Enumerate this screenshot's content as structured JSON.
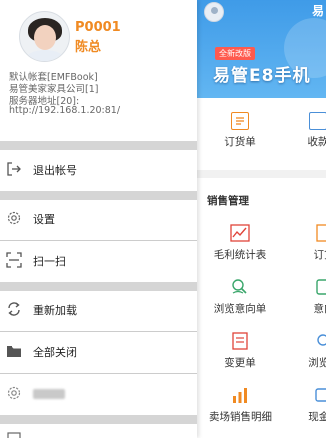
{
  "drawer": {
    "profile": {
      "user_code": "P0001",
      "user_name": "陈总",
      "lines": [
        "默认帐套[EMFBook]",
        "易管美家家具公司[1]",
        "服务器地址[20]:",
        "http://192.168.1.20:81/"
      ]
    },
    "menu": [
      {
        "label": "退出帐号",
        "icon": "logout-icon"
      },
      {
        "label": "设置",
        "icon": "gear-icon"
      },
      {
        "label": "扫一扫",
        "icon": "scan-icon"
      },
      {
        "label": "重新加载",
        "icon": "reload-icon"
      },
      {
        "label": "全部关闭",
        "icon": "folder-icon"
      },
      {
        "label": "",
        "icon": "gear-icon"
      }
    ]
  },
  "app": {
    "corner_text": "易",
    "banner": {
      "tag": "全新改版",
      "title": "易管E8手机"
    },
    "quick": [
      {
        "label": "订货单",
        "icon": "order-icon"
      },
      {
        "label": "收款",
        "icon": "receipt-icon"
      }
    ],
    "section_title": "销售管理",
    "grid": [
      {
        "label": "毛利统计表",
        "icon": "line-chart-icon"
      },
      {
        "label": "订货",
        "icon": "order-icon"
      },
      {
        "label": "浏览意向单",
        "icon": "intent-view-icon"
      },
      {
        "label": "意向",
        "icon": "intent-icon"
      },
      {
        "label": "变更单",
        "icon": "change-icon"
      },
      {
        "label": "浏览收",
        "icon": "receipt-view-icon"
      },
      {
        "label": "卖场销售明细",
        "icon": "bar-chart-icon"
      },
      {
        "label": "现金日",
        "icon": "cash-icon"
      }
    ],
    "accent_color": "#f08a22",
    "green_color": "#3aa66b",
    "red_color": "#e0443a"
  }
}
